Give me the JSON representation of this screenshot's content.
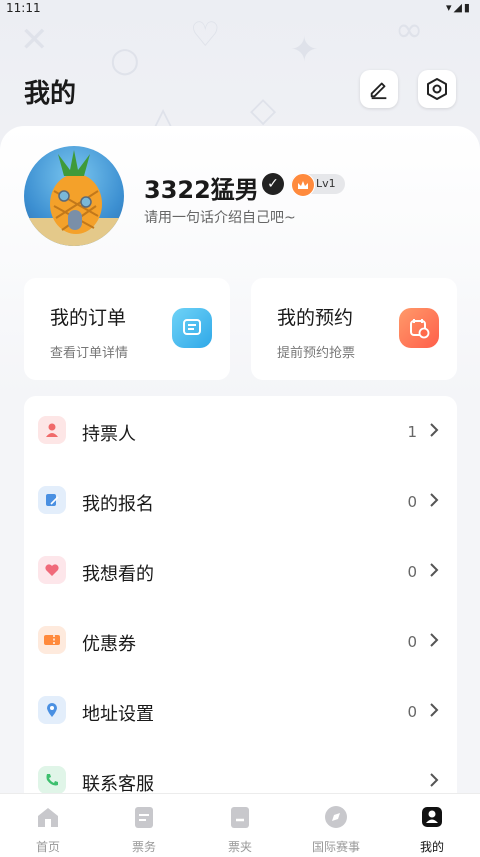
{
  "status": {
    "time": "11:11"
  },
  "header": {
    "title": "我的"
  },
  "profile": {
    "username": "3322猛男",
    "level": "Lv1",
    "bio": "请用一句话介绍自己吧~"
  },
  "quick_cards": [
    {
      "title": "我的订单",
      "subtitle": "查看订单详情",
      "color": "#3fb8ee"
    },
    {
      "title": "我的预约",
      "subtitle": "提前预约抢票",
      "color": "#ff7a52"
    }
  ],
  "menu": [
    {
      "label": "持票人",
      "count": "1",
      "icon": "person-icon",
      "color": "#f06a6a"
    },
    {
      "label": "我的报名",
      "count": "0",
      "icon": "edit-doc-icon",
      "color": "#4a90e2"
    },
    {
      "label": "我想看的",
      "count": "0",
      "icon": "heart-icon",
      "color": "#f06a7a"
    },
    {
      "label": "优惠券",
      "count": "0",
      "icon": "ticket-icon",
      "color": "#ff8a3d"
    },
    {
      "label": "地址设置",
      "count": "0",
      "icon": "location-icon",
      "color": "#4a90e2"
    },
    {
      "label": "联系客服",
      "count": "",
      "icon": "phone-icon",
      "color": "#3dbf6e"
    }
  ],
  "tabs": [
    {
      "label": "首页",
      "icon": "home-icon"
    },
    {
      "label": "票务",
      "icon": "tickets-icon"
    },
    {
      "label": "票夹",
      "icon": "wallet-icon"
    },
    {
      "label": "国际赛事",
      "icon": "compass-icon"
    },
    {
      "label": "我的",
      "icon": "profile-icon",
      "active": true
    }
  ]
}
